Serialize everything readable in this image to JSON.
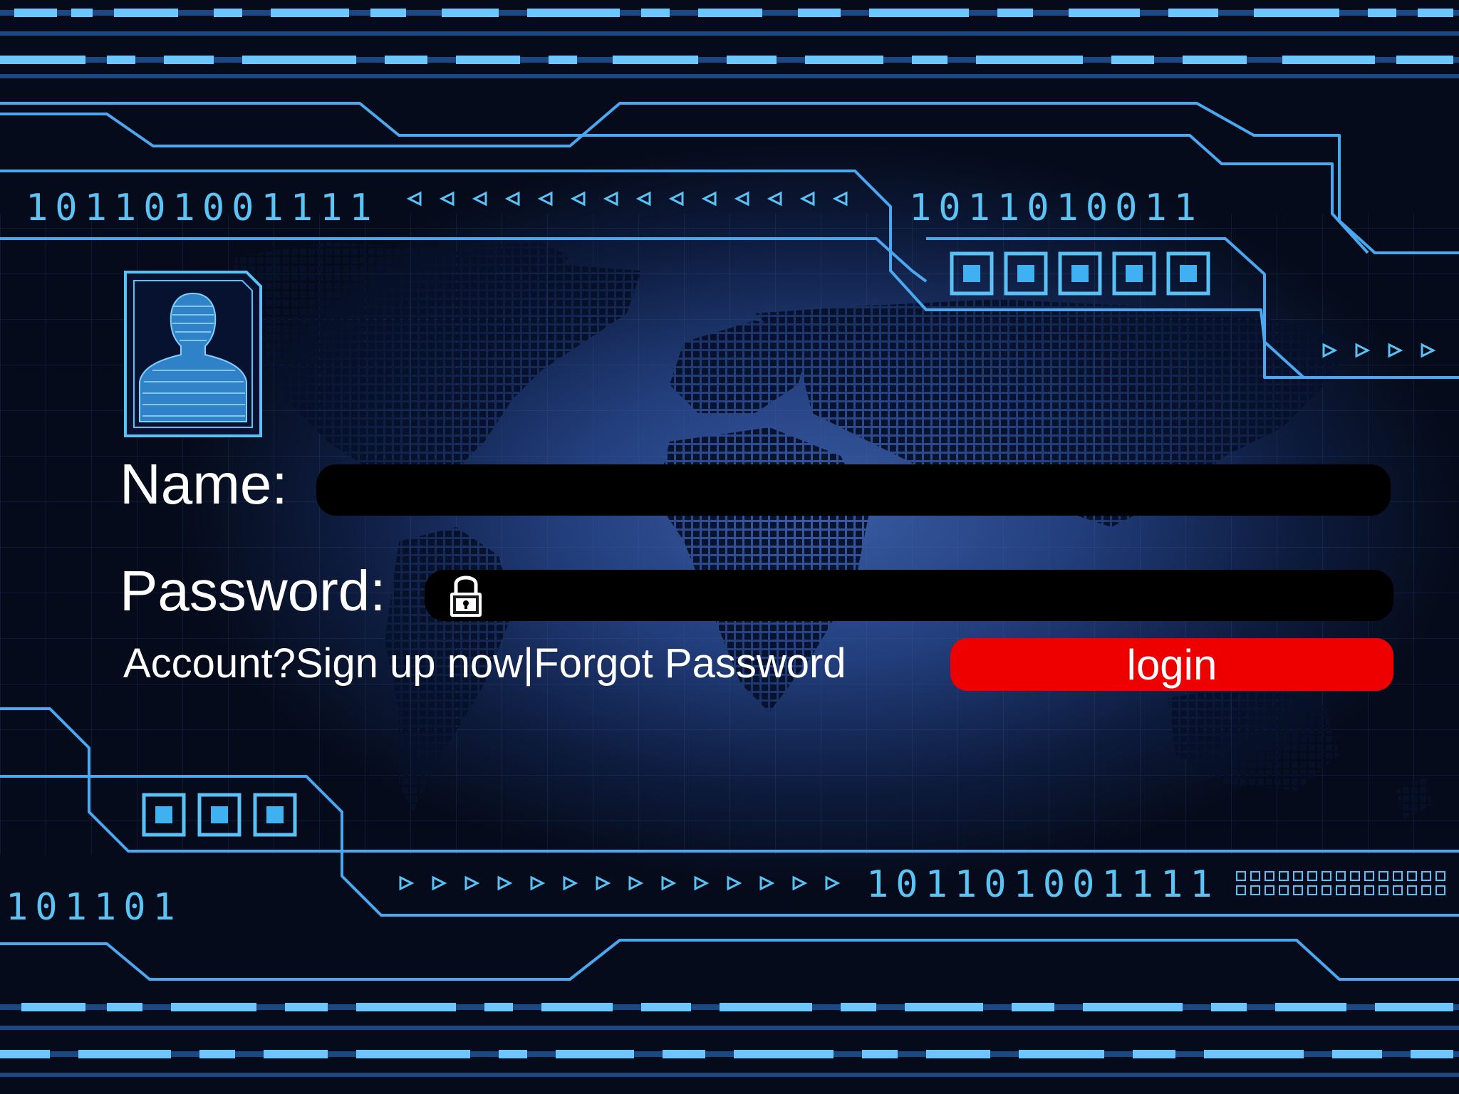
{
  "form": {
    "name_label": "Name:",
    "password_label": "Password:",
    "name_value": "",
    "password_value": "",
    "link_account": "Account?",
    "link_signup": "Sign up now",
    "link_separator": "|",
    "link_forgot": "Forgot Password",
    "login_label": "login"
  },
  "decor": {
    "binary_top_left": "101101001111",
    "binary_top_right": "1011010011",
    "binary_bottom_right": "101101001111",
    "binary_bottom_left": "101101"
  },
  "colors": {
    "accent_line": "#4aa8f0",
    "login_button": "#ee0000",
    "field_background": "#000000"
  },
  "icons": [
    "avatar-icon",
    "lock-icon"
  ]
}
